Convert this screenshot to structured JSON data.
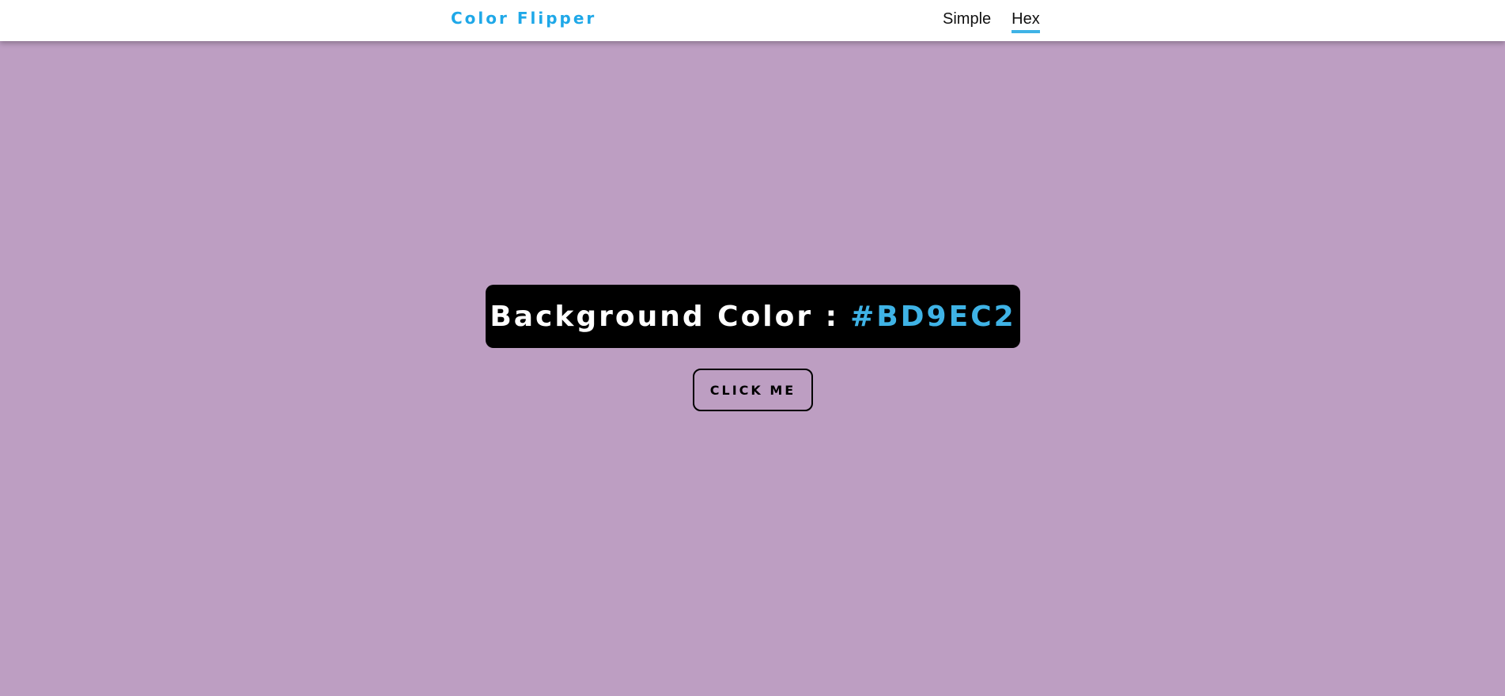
{
  "navbar": {
    "brand": "Color Flipper",
    "links": [
      {
        "label": "Simple",
        "active": false
      },
      {
        "label": "Hex",
        "active": true
      }
    ]
  },
  "main": {
    "color_label": "Background Color :",
    "color_value": "#BD9EC2",
    "button_label": "CLICK ME"
  },
  "colors": {
    "background": "#BD9EC2",
    "brand": "#1fa8e8",
    "accent": "#3fb3e6",
    "panel": "#000000"
  }
}
